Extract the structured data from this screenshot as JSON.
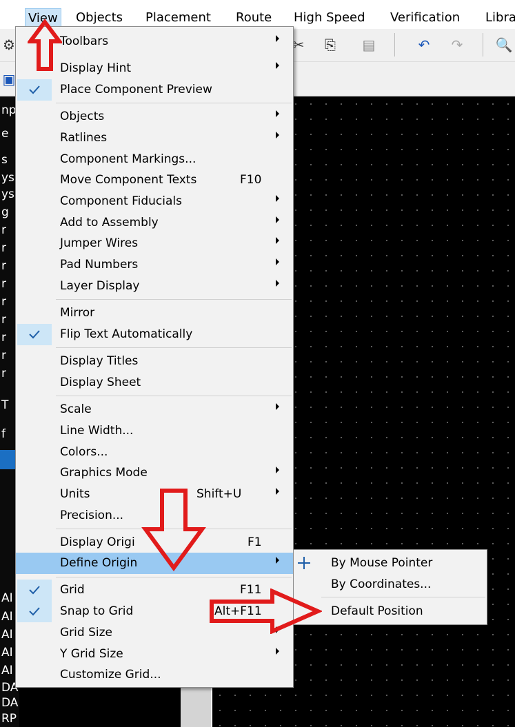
{
  "menubar": {
    "items": [
      "View",
      "Objects",
      "Placement",
      "Route",
      "High Speed",
      "Verification",
      "Libra"
    ]
  },
  "left_panel": {
    "fragments": [
      "np",
      "e",
      "s",
      "ys",
      "ys",
      "g",
      "r",
      "r",
      "r",
      "r",
      "r",
      "r",
      "r",
      "r",
      "r",
      "T",
      "f",
      "AI",
      "AI",
      "AI",
      "AI",
      "AI",
      "DA",
      "DAP",
      "RP"
    ]
  },
  "view_menu": {
    "toolbars": "Toolbars",
    "display_hint": "Display Hint",
    "place_component_preview": "Place Component Preview",
    "objects": "Objects",
    "ratlines": "Ratlines",
    "component_markings": "Component Markings...",
    "move_component_texts": "Move Component Texts",
    "move_component_texts_shortcut": "F10",
    "component_fiducials": "Component Fiducials",
    "add_to_assembly": "Add to Assembly",
    "jumper_wires": "Jumper Wires",
    "pad_numbers": "Pad Numbers",
    "layer_display": "Layer Display",
    "mirror": "Mirror",
    "flip_text_automatically": "Flip Text Automatically",
    "display_titles": "Display Titles",
    "display_sheet": "Display Sheet",
    "scale": "Scale",
    "line_width": "Line Width...",
    "colors": "Colors...",
    "graphics_mode": "Graphics Mode",
    "units": "Units",
    "units_shortcut": "Shift+U",
    "precision": "Precision...",
    "display_origin": "Display Origi",
    "display_origin_shortcut": "F1",
    "define_origin": "Define Origin",
    "grid": "Grid",
    "grid_shortcut": "F11",
    "snap_to_grid": "Snap to Grid",
    "snap_to_grid_shortcut": "Alt+F11",
    "grid_size": "Grid Size",
    "y_grid_size": "Y Grid Size",
    "customize_grid": "Customize Grid..."
  },
  "define_origin_submenu": {
    "by_mouse_pointer": "By Mouse Pointer",
    "by_coordinates": "By Coordinates...",
    "default_position": "Default Position"
  },
  "colors": {
    "menu_bg": "#f2f2f2",
    "highlight": "#99c9f2",
    "check_bg": "#cde6f7",
    "annotation_red": "#e11b1b",
    "canvas_bg": "#000000"
  }
}
